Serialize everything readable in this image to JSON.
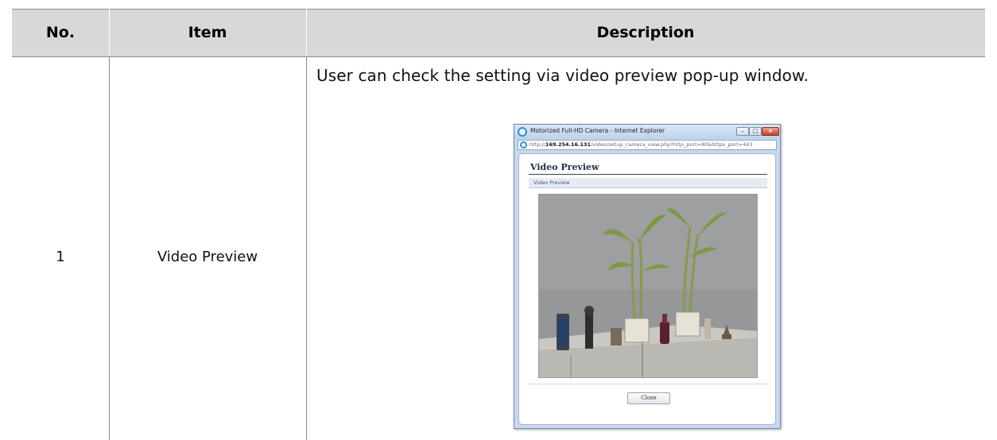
{
  "table": {
    "headers": {
      "no": "No.",
      "item": "Item",
      "description": "Description"
    },
    "rows": [
      {
        "no": "1",
        "item": "Video Preview",
        "description": "User can check the setting via video preview pop-up window."
      }
    ]
  },
  "popup": {
    "window_title": "Motorized Full-HD Camera - Internet Explorer",
    "url_prefix": "http://",
    "url_host": "169.254.16.131",
    "url_path": "/video/setup_camera_view.php?http_port=80&https_port=443",
    "heading": "Video Preview",
    "tab_label": "Video Preview",
    "close_button_label": "Close",
    "icons": {
      "browser": "ie-logo-icon",
      "page": "ie-page-icon",
      "minimize": "minimize-icon",
      "maximize": "maximize-icon",
      "close": "close-icon"
    }
  }
}
